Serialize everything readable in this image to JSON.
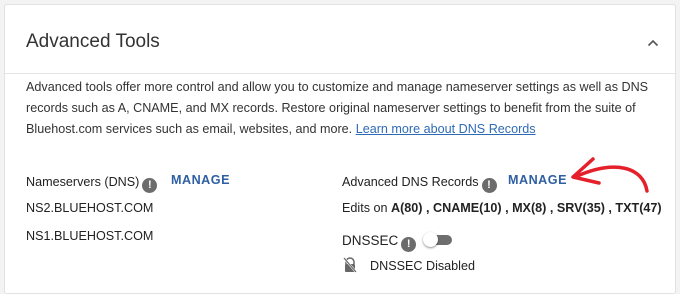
{
  "panel": {
    "title": "Advanced Tools",
    "description": "Advanced tools offer more control and allow you to customize and manage nameserver settings as well as DNS records such as A, CNAME, and MX records. Restore original nameserver settings to benefit from the suite of Bluehost.com services such as email, websites, and more.",
    "learn_more_link": "Learn more about DNS Records"
  },
  "nameservers": {
    "label": "Nameservers (DNS)",
    "info_glyph": "!",
    "manage_label": "MANAGE",
    "servers": [
      "NS2.BLUEHOST.COM",
      "NS1.BLUEHOST.COM"
    ]
  },
  "dns_records": {
    "label": "Advanced DNS Records",
    "info_glyph": "!",
    "manage_label": "MANAGE",
    "edits_prefix": "Edits on",
    "edits_summary": "A(80) , CNAME(10) , MX(8) , SRV(35) , TXT(47)"
  },
  "dnssec": {
    "label": "DNSSEC",
    "info_glyph": "!",
    "enabled": false,
    "status_text": "DNSSEC Disabled"
  },
  "colors": {
    "link": "#2f6bb5",
    "manage": "#2f5fa3",
    "annotation_arrow": "#e4202a"
  }
}
